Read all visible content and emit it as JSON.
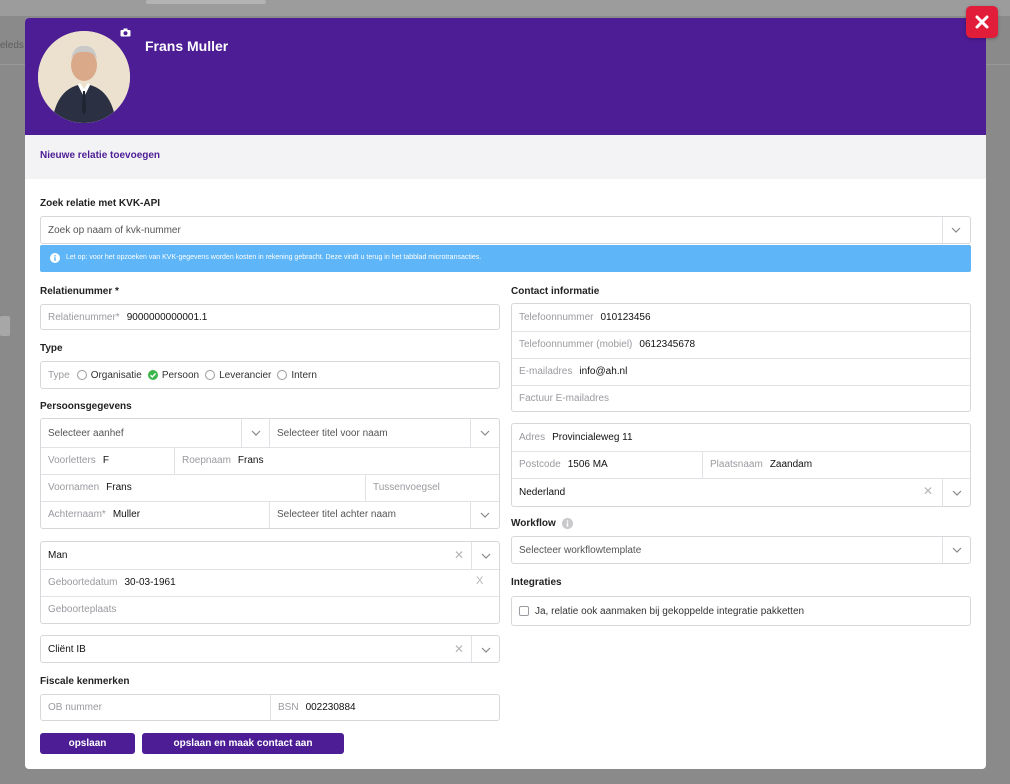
{
  "backdrop": {
    "partial_text": "eleds"
  },
  "header": {
    "name": "Frans Muller"
  },
  "subheader": {
    "title": "Nieuwe relatie toevoegen"
  },
  "kvk": {
    "label": "Zoek relatie met KVK-API",
    "placeholder": "Zoek op naam of kvk-nummer",
    "info": "Let op: voor het opzoeken van KVK-gegevens worden kosten in rekening gebracht. Deze vindt u terug in het tabblad microtransacties."
  },
  "relatienummer": {
    "label": "Relatienummer *",
    "placeholder": "Relatienummer*",
    "value": "9000000000001.1"
  },
  "type": {
    "label": "Type",
    "placeholder": "Type",
    "options": [
      {
        "label": "Organisatie",
        "checked": false
      },
      {
        "label": "Persoon",
        "checked": true
      },
      {
        "label": "Leverancier",
        "checked": false
      },
      {
        "label": "Intern",
        "checked": false
      }
    ]
  },
  "persoon": {
    "label": "Persoonsgegevens",
    "aanhef_placeholder": "Selecteer aanhef",
    "titel_voor_placeholder": "Selecteer titel voor naam",
    "voorletters": {
      "placeholder": "Voorletters",
      "value": "F"
    },
    "roepnaam": {
      "placeholder": "Roepnaam",
      "value": "Frans"
    },
    "voornamen": {
      "placeholder": "Voornamen",
      "value": "Frans"
    },
    "tussenvoegsel": {
      "placeholder": "Tussenvoegsel",
      "value": ""
    },
    "achternaam": {
      "placeholder": "Achternaam*",
      "value": "Muller"
    },
    "titel_achter_placeholder": "Selecteer titel achter naam",
    "geslacht": "Man",
    "geboortedatum": {
      "placeholder": "Geboortedatum",
      "value": "30-03-1961",
      "clear": "X"
    },
    "geboorteplaats": {
      "placeholder": "Geboorteplaats",
      "value": ""
    },
    "client_type": "Cliënt IB"
  },
  "fiscaal": {
    "label": "Fiscale kenmerken",
    "ob": {
      "placeholder": "OB nummer",
      "value": ""
    },
    "bsn": {
      "placeholder": "BSN",
      "value": "002230884"
    }
  },
  "contact": {
    "label": "Contact informatie",
    "telefoon": {
      "placeholder": "Telefoonnummer",
      "value": "010123456"
    },
    "mobiel": {
      "placeholder": "Telefoonnummer (mobiel)",
      "value": "0612345678"
    },
    "email": {
      "placeholder": "E-mailadres",
      "value": "info@ah.nl"
    },
    "factuur_email": {
      "placeholder": "Factuur E-mailadres",
      "value": ""
    },
    "adres": {
      "placeholder": "Adres",
      "value": "Provincialeweg 11"
    },
    "postcode": {
      "placeholder": "Postcode",
      "value": "1506 MA"
    },
    "plaatsnaam": {
      "placeholder": "Plaatsnaam",
      "value": "Zaandam"
    },
    "land": "Nederland"
  },
  "workflow": {
    "label": "Workflow",
    "placeholder": "Selecteer workflowtemplate"
  },
  "integraties": {
    "label": "Integraties",
    "checkbox_label": "Ja, relatie ook aanmaken bij gekoppelde integratie pakketten"
  },
  "buttons": {
    "save": "opslaan",
    "save_contact": "opslaan en maak contact aan"
  },
  "colors": {
    "header": "#4c1d95",
    "info": "#5eb5f7",
    "close": "#e11d3a",
    "checked": "#3bb54a"
  }
}
